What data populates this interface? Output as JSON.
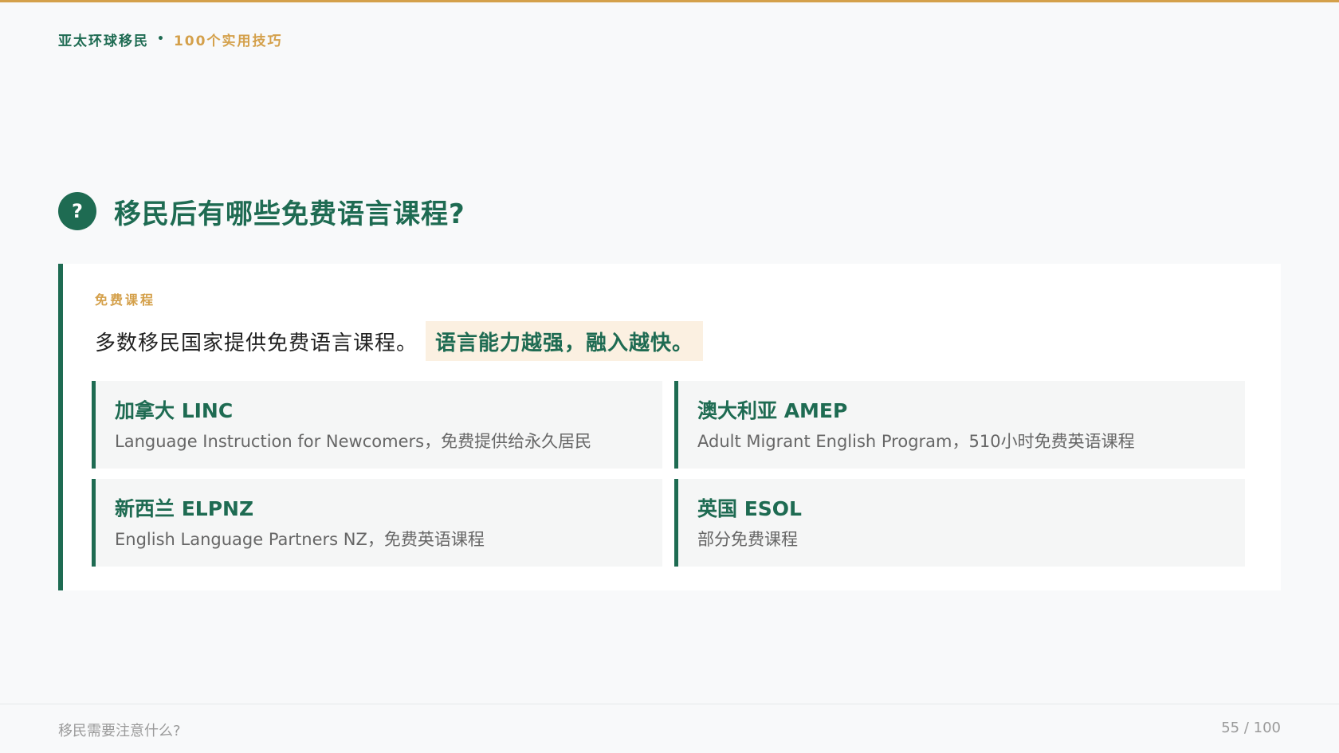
{
  "brand": {
    "name": "亚太环球移民",
    "separator": "•",
    "subtitle": "100个实用技巧"
  },
  "heading": {
    "icon": "?",
    "title": "移民后有哪些免费语言课程?"
  },
  "card": {
    "tag": "免费课程",
    "lead": "多数移民国家提供免费语言课程。",
    "highlight": "语言能力越强，融入越快。",
    "items": [
      {
        "title": "加拿大 LINC",
        "desc": "Language Instruction for Newcomers，免费提供给永久居民"
      },
      {
        "title": "澳大利亚 AMEP",
        "desc": "Adult Migrant English Program，510小时免费英语课程"
      },
      {
        "title": "新西兰 ELPNZ",
        "desc": "English Language Partners NZ，免费英语课程"
      },
      {
        "title": "英国 ESOL",
        "desc": "部分免费课程"
      }
    ]
  },
  "footer": {
    "left": "移民需要注意什么?",
    "right": "55 / 100"
  },
  "colors": {
    "primary": "#1e6b52",
    "accent": "#d4a04a",
    "highlight_bg": "#fbf0e1"
  }
}
